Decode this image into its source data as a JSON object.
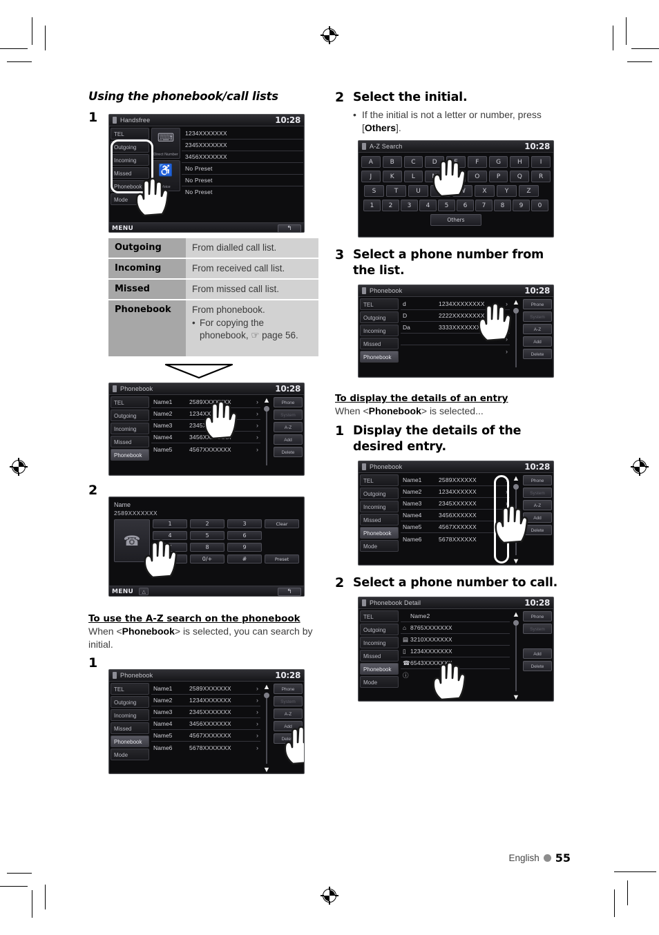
{
  "page": {
    "section_heading": "Using the phonebook/call lists",
    "footer_language": "English",
    "footer_page_number": "55"
  },
  "left_column": {
    "step1_num": "1",
    "handsfree_screen": {
      "title": "Handsfree",
      "clock": "10:28",
      "nav_items": [
        "TEL",
        "Outgoing",
        "Incoming",
        "Missed",
        "Phonebook",
        "Mode"
      ],
      "icon_buttons": [
        {
          "label": "Direct Number",
          "icon": "direct-number-icon"
        },
        {
          "label": "Voice",
          "icon": "voice-icon"
        }
      ],
      "presets": [
        "1234XXXXXXX",
        "2345XXXXXXX",
        "3456XXXXXXX",
        "No Preset",
        "No Preset",
        "No Preset"
      ],
      "menu_label": "MENU",
      "back_label": "↰"
    },
    "desc_table": {
      "rows": [
        {
          "key": "Outgoing",
          "value": "From dialled call list."
        },
        {
          "key": "Incoming",
          "value": "From received call list."
        },
        {
          "key": "Missed",
          "value": "From missed call list."
        },
        {
          "key": "Phonebook",
          "value": "From phonebook.",
          "sub": "For copying the phonebook, ☞ page 56."
        }
      ]
    },
    "phonebook_screen": {
      "title": "Phonebook",
      "clock": "10:28",
      "nav_items": [
        "TEL",
        "Outgoing",
        "Incoming",
        "Missed",
        "Phonebook"
      ],
      "nav_selected": "Phonebook",
      "rows": [
        {
          "name": "Name1",
          "number": "2589XXXXXXX"
        },
        {
          "name": "Name2",
          "number": "1234XXXXXXX"
        },
        {
          "name": "Name3",
          "number": "2345XXXXXXX"
        },
        {
          "name": "Name4",
          "number": "3456XXXXXXX"
        },
        {
          "name": "Name5",
          "number": "4567XXXXXXX"
        }
      ],
      "side_buttons": [
        "Phone",
        "System",
        "A-Z",
        "Add",
        "Delete"
      ]
    },
    "step2_num": "2",
    "dial_screen": {
      "name_label": "Name",
      "number": "2589XXXXXXX",
      "keys": [
        [
          "1",
          "2",
          "3",
          "Clear"
        ],
        [
          "4",
          "5",
          "6"
        ],
        [
          "7",
          "8",
          "9"
        ],
        [
          "*",
          "0/+",
          "#",
          "Preset"
        ]
      ],
      "call_icon": "call-handset-icon",
      "menu_label": "MENU",
      "back_label": "↰"
    },
    "az_subhead": "To use the A-Z search on the phonebook",
    "az_text_pre": "When <",
    "az_text_bold": "Phonebook",
    "az_text_post": "> is selected, you can search by initial.",
    "az_step1_num": "1",
    "az_phonebook_screen": {
      "title": "Phonebook",
      "clock": "10:28",
      "nav_items": [
        "TEL",
        "Outgoing",
        "Incoming",
        "Missed",
        "Phonebook",
        "Mode"
      ],
      "nav_selected": "Phonebook",
      "rows": [
        {
          "name": "Name1",
          "number": "2589XXXXXXX"
        },
        {
          "name": "Name2",
          "number": "1234XXXXXXX"
        },
        {
          "name": "Name3",
          "number": "2345XXXXXXX"
        },
        {
          "name": "Name4",
          "number": "3456XXXXXXX"
        },
        {
          "name": "Name5",
          "number": "4567XXXXXXX"
        },
        {
          "name": "Name6",
          "number": "5678XXXXXXX"
        }
      ],
      "side_buttons": [
        "Phone",
        "System",
        "A-Z",
        "Add",
        "Delete"
      ]
    }
  },
  "right_column": {
    "step2_num": "2",
    "step2_title": "Select the initial.",
    "step2_bullet_pre": "If the initial is not a letter or number, press [",
    "step2_bullet_bold": "Others",
    "step2_bullet_post": "].",
    "az_search_screen": {
      "title": "A-Z Search",
      "clock": "10:28",
      "rows": [
        [
          "A",
          "B",
          "C",
          "D",
          "E",
          "F",
          "G",
          "H",
          "I"
        ],
        [
          "J",
          "K",
          "L",
          "M",
          "N",
          "O",
          "P",
          "Q",
          "R"
        ],
        [
          "S",
          "T",
          "U",
          "V",
          "W",
          "X",
          "Y",
          "Z"
        ],
        [
          "1",
          "2",
          "3",
          "4",
          "5",
          "6",
          "7",
          "8",
          "9",
          "0"
        ]
      ],
      "others_label": "Others"
    },
    "step3_num": "3",
    "step3_title": "Select a phone number from the list.",
    "result_screen": {
      "title": "Phonebook",
      "clock": "10:28",
      "nav_items": [
        "TEL",
        "Outgoing",
        "Incoming",
        "Missed",
        "Phonebook"
      ],
      "nav_selected": "Phonebook",
      "rows": [
        {
          "name": "d",
          "number": "1234XXXXXXXX"
        },
        {
          "name": "D",
          "number": "2222XXXXXXXX"
        },
        {
          "name": "Da",
          "number": "3333XXXXXXXX"
        },
        {
          "name": "",
          "number": ""
        },
        {
          "name": "",
          "number": ""
        }
      ],
      "side_buttons": [
        "Phone",
        "System",
        "A-Z",
        "Add",
        "Delete"
      ]
    },
    "detail_subhead": "To display the details of an entry",
    "detail_text_pre": "When <",
    "detail_text_bold": "Phonebook",
    "detail_text_post": "> is selected...",
    "detail_step1_num": "1",
    "detail_step1_title": "Display the details of the desired entry.",
    "detail_list_screen": {
      "title": "Phonebook",
      "clock": "10:28",
      "nav_items": [
        "TEL",
        "Outgoing",
        "Incoming",
        "Missed",
        "Phonebook",
        "Mode"
      ],
      "nav_selected": "Phonebook",
      "rows": [
        {
          "name": "Name1",
          "number": "2589XXXXXX"
        },
        {
          "name": "Name2",
          "number": "1234XXXXXX"
        },
        {
          "name": "Name3",
          "number": "2345XXXXXX"
        },
        {
          "name": "Name4",
          "number": "3456XXXXXX"
        },
        {
          "name": "Name5",
          "number": "4567XXXXXX"
        },
        {
          "name": "Name6",
          "number": "5678XXXXXX"
        }
      ],
      "side_buttons": [
        "Phone",
        "System",
        "A-Z",
        "Add",
        "Delete"
      ]
    },
    "detail_step2_num": "2",
    "detail_step2_title": "Select a phone number to call.",
    "detail_screen": {
      "title": "Phonebook Detail",
      "clock": "10:28",
      "nav_items": [
        "TEL",
        "Outgoing",
        "Incoming",
        "Missed",
        "Phonebook",
        "Mode"
      ],
      "nav_selected": "Phonebook",
      "rows": [
        {
          "icon": "",
          "text": "Name2"
        },
        {
          "icon": "home-icon",
          "text": "8765XXXXXXX"
        },
        {
          "icon": "office-icon",
          "text": "3210XXXXXXX"
        },
        {
          "icon": "mobile-icon",
          "text": "1234XXXXXXX"
        },
        {
          "icon": "phone-icon",
          "text": "6543XXXXXXX"
        },
        {
          "icon": "other-icon",
          "text": ""
        }
      ],
      "side_buttons": [
        "Phone",
        "System",
        "",
        "Add",
        "Delete"
      ]
    }
  }
}
